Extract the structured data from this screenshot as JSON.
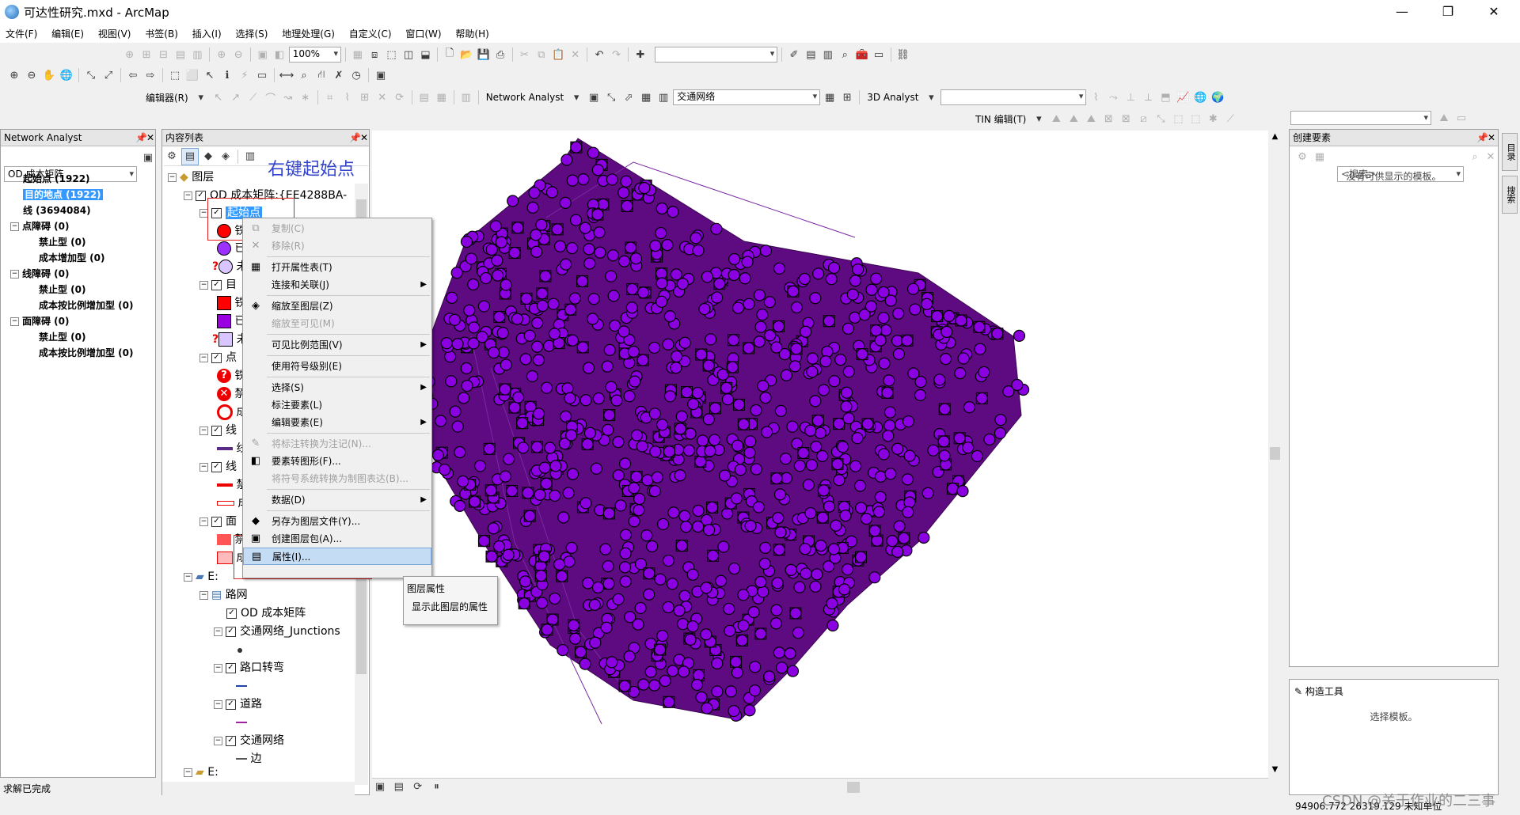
{
  "window": {
    "title": "可达性研究.mxd - ArcMap",
    "minimize": "—",
    "maximize": "❐",
    "close": "✕"
  },
  "menu": [
    "文件(F)",
    "编辑(E)",
    "视图(V)",
    "书签(B)",
    "插入(I)",
    "选择(S)",
    "地理处理(G)",
    "自定义(C)",
    "窗口(W)",
    "帮助(H)"
  ],
  "toolbar": {
    "zoom_value": "100%",
    "editor_label": "编辑器(R)",
    "network_analyst_label": "Network Analyst",
    "network_dataset": "交通网络",
    "analyst3d_label": "3D Analyst",
    "tin_edit_label": "TIN 编辑(T)"
  },
  "na_window": {
    "title": "Network Analyst",
    "layer": "OD 成本矩阵",
    "items": [
      {
        "label": "起始点 (1922)",
        "level": 1,
        "expander": "",
        "selected": false
      },
      {
        "label": "目的地点 (1922)",
        "level": 1,
        "expander": "",
        "selected": true
      },
      {
        "label": "线 (3694084)",
        "level": 1,
        "expander": "",
        "selected": false
      },
      {
        "label": "点障碍 (0)",
        "level": 0,
        "expander": "−",
        "selected": false
      },
      {
        "label": "禁止型 (0)",
        "level": 2,
        "expander": "",
        "selected": false
      },
      {
        "label": "成本增加型 (0)",
        "level": 2,
        "expander": "",
        "selected": false
      },
      {
        "label": "线障碍 (0)",
        "level": 0,
        "expander": "−",
        "selected": false
      },
      {
        "label": "禁止型 (0)",
        "level": 2,
        "expander": "",
        "selected": false
      },
      {
        "label": "成本按比例增加型 (0)",
        "level": 2,
        "expander": "",
        "selected": false
      },
      {
        "label": "面障碍 (0)",
        "level": 0,
        "expander": "−",
        "selected": false
      },
      {
        "label": "禁止型 (0)",
        "level": 2,
        "expander": "",
        "selected": false
      },
      {
        "label": "成本按比例增加型 (0)",
        "level": 2,
        "expander": "",
        "selected": false
      }
    ]
  },
  "toc": {
    "title": "内容列表",
    "annotation": "右键起始点   选择属性",
    "root": "图层",
    "od_layer": "OD 成本矩阵:{EE4288BA-",
    "origins": "起始点",
    "trunc": [
      "铁",
      "已",
      "未",
      "目",
      "铁",
      "已",
      "未",
      "点",
      "铁",
      "禁",
      "成",
      "线",
      "线",
      "线",
      "禁",
      "成",
      "面",
      "禁",
      "成"
    ],
    "db_root": "E:",
    "db_root2": "E:",
    "dataset": "路网",
    "children": [
      "OD 成本矩阵",
      "交通网络_Junctions",
      "路口转弯",
      "道路",
      "交通网络"
    ],
    "edge_label": "边"
  },
  "context_menu": {
    "items": [
      {
        "label": "复制(C)",
        "enabled": false,
        "icon": "copy-icon",
        "glyph": "⧉",
        "submenu": false
      },
      {
        "label": "移除(R)",
        "enabled": false,
        "icon": "remove-icon",
        "glyph": "✕",
        "submenu": false
      },
      {
        "label": "打开属性表(T)",
        "enabled": true,
        "icon": "table-icon",
        "glyph": "▦",
        "submenu": false
      },
      {
        "label": "连接和关联(J)",
        "enabled": true,
        "icon": "",
        "glyph": "",
        "submenu": true
      },
      {
        "label": "缩放至图层(Z)",
        "enabled": true,
        "icon": "zoom-layer-icon",
        "glyph": "◈",
        "submenu": false
      },
      {
        "label": "缩放至可见(M)",
        "enabled": false,
        "icon": "",
        "glyph": "",
        "submenu": false
      },
      {
        "label": "可见比例范围(V)",
        "enabled": true,
        "icon": "",
        "glyph": "",
        "submenu": true
      },
      {
        "label": "使用符号级别(E)",
        "enabled": true,
        "icon": "",
        "glyph": "",
        "submenu": false
      },
      {
        "label": "选择(S)",
        "enabled": true,
        "icon": "",
        "glyph": "",
        "submenu": true
      },
      {
        "label": "标注要素(L)",
        "enabled": true,
        "icon": "",
        "glyph": "",
        "submenu": false
      },
      {
        "label": "编辑要素(E)",
        "enabled": true,
        "icon": "",
        "glyph": "",
        "submenu": true
      },
      {
        "label": "将标注转换为注记(N)...",
        "enabled": false,
        "icon": "annotation-icon",
        "glyph": "✎",
        "submenu": false
      },
      {
        "label": "要素转图形(F)...",
        "enabled": true,
        "icon": "graphics-icon",
        "glyph": "◧",
        "submenu": false
      },
      {
        "label": "将符号系统转换为制图表达(B)...",
        "enabled": false,
        "icon": "",
        "glyph": "",
        "submenu": false
      },
      {
        "label": "数据(D)",
        "enabled": true,
        "icon": "",
        "glyph": "",
        "submenu": true
      },
      {
        "label": "另存为图层文件(Y)...",
        "enabled": true,
        "icon": "layer-file-icon",
        "glyph": "◆",
        "submenu": false
      },
      {
        "label": "创建图层包(A)...",
        "enabled": true,
        "icon": "layer-package-icon",
        "glyph": "▣",
        "submenu": false
      },
      {
        "label": "属性(I)...",
        "enabled": true,
        "icon": "properties-icon",
        "glyph": "▤",
        "submenu": false,
        "highlighted": true
      }
    ],
    "tooltip_title": "图层属性",
    "tooltip_body": "显示此图层的属性"
  },
  "create_features": {
    "title": "创建要素",
    "search_placeholder": "<搜索>",
    "empty_text": "没有可供显示的模板。",
    "construct_title": "构造工具",
    "construct_text": "选择模板。"
  },
  "side_tabs": [
    "目录",
    "搜索"
  ],
  "status": {
    "left": "求解已完成",
    "coords": "94906.772  26319.129 未知单位",
    "watermark": "CSDN @关于作业的二三事"
  },
  "colors": {
    "feature_fill": "#6a0dad",
    "points": "#8b00e0",
    "annotation_text": "#3344cc",
    "selection": "#3399ff",
    "highlight_box": "#e02020"
  }
}
